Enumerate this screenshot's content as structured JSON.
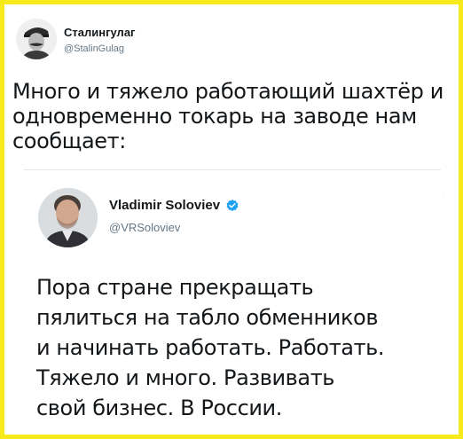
{
  "outer_tweet": {
    "display_name": "Сталингулаг",
    "handle": "@StalinGulag",
    "text_lines": [
      "Много и тяжело работающий шахтёр и",
      "одновременно токарь на заводе нам",
      "сообщает:"
    ]
  },
  "quoted_tweet": {
    "display_name": "Vladimir Soloviev",
    "verified_icon": "verified-badge-icon",
    "handle": "@VRSoloviev",
    "text_lines": [
      "Пора стране прекращать",
      "пялиться на табло обменников",
      "и начинать работать. Работать.",
      "Тяжело и много. Развивать",
      "свой бизнес. В России."
    ]
  },
  "colors": {
    "frame_border": "#f7ea1a",
    "verified_blue": "#1da1f2",
    "text": "#14171a",
    "secondary_text": "#657786"
  }
}
